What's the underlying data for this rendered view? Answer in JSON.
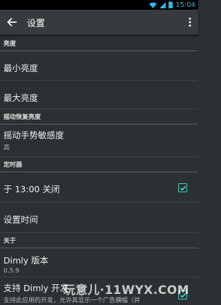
{
  "status": {
    "time": "15:04"
  },
  "appbar": {
    "title": "设置"
  },
  "sections": {
    "brightness": {
      "header": "亮度",
      "min": "最小亮度",
      "max": "最大亮度"
    },
    "shake": {
      "header": "摇动恢复亮度",
      "sensitivity_title": "摇动手势敏感度",
      "sensitivity_value": "高"
    },
    "timer": {
      "header": "定时器",
      "close_at": "于 13:00 关闭",
      "set_time": "设置时间"
    },
    "about": {
      "header": "关于",
      "version_title": "Dimly 版本",
      "version_value": "0.5.9",
      "support_title": "支持 Dimly 开发",
      "support_desc": "支持此应用的开发，允许其显示一个广告横幅（并"
    }
  },
  "watermark": "玩意儿·11WYX.COM",
  "colors": {
    "accent": "#4fd1c5",
    "background": "#2b3033"
  }
}
